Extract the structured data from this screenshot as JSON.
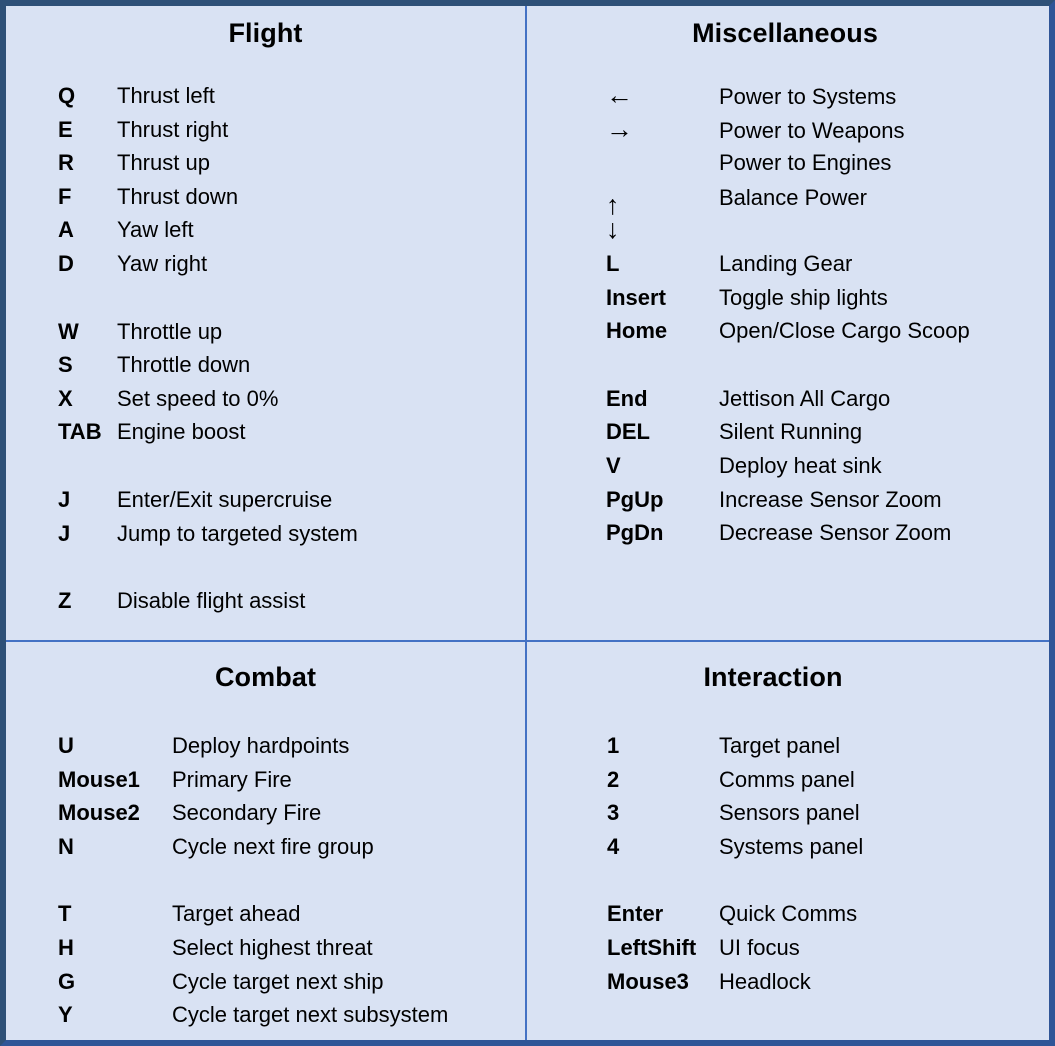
{
  "card": {
    "background_color": "#D9E2F3",
    "border_color": "#2E5077",
    "divider_color": "#4472C4"
  },
  "panels": [
    {
      "id": "flight",
      "title": "Flight",
      "groups": [
        {
          "rows": [
            {
              "key": "Q",
              "desc": "Thrust left"
            },
            {
              "key": "E",
              "desc": "Thrust right"
            },
            {
              "key": "R",
              "desc": "Thrust up"
            },
            {
              "key": "F",
              "desc": "Thrust down"
            },
            {
              "key": "A",
              "desc": "Yaw left"
            },
            {
              "key": "D",
              "desc": "Yaw right"
            }
          ]
        },
        {
          "rows": [
            {
              "key": "W",
              "desc": "Throttle up"
            },
            {
              "key": "S",
              "desc": "Throttle down"
            },
            {
              "key": "X",
              "desc": "Set speed to 0%"
            },
            {
              "key": "TAB",
              "desc": "Engine boost"
            }
          ]
        },
        {
          "rows": [
            {
              "key": "J",
              "desc": "Enter/Exit supercruise"
            },
            {
              "key": "J",
              "desc": "Jump to targeted system"
            }
          ]
        },
        {
          "rows": [
            {
              "key": "Z",
              "desc": "Disable flight assist"
            }
          ]
        }
      ]
    },
    {
      "id": "miscellaneous",
      "title": "Miscellaneous",
      "groups": [
        {
          "rows": [
            {
              "key": "←",
              "desc": "Power to Systems",
              "key_style": "arrow"
            },
            {
              "key": "→",
              "desc": "Power to Weapons",
              "key_style": "arrow"
            },
            {
              "key": "",
              "desc": "Power to Engines"
            },
            {
              "key": "↑",
              "desc": "Balance Power",
              "key_style": "arrow",
              "key_nudge": true
            },
            {
              "key": "↓",
              "desc": "",
              "key_style": "arrow"
            },
            {
              "key": "L",
              "desc": "Landing Gear"
            },
            {
              "key": "Insert",
              "desc": "Toggle ship lights"
            },
            {
              "key": "Home",
              "desc": "Open/Close Cargo Scoop"
            }
          ]
        },
        {
          "rows": [
            {
              "key": "End",
              "desc": "Jettison All Cargo"
            },
            {
              "key": "DEL",
              "desc": "Silent Running"
            },
            {
              "key": "V",
              "desc": "Deploy heat sink"
            },
            {
              "key": "PgUp",
              "desc": "Increase Sensor Zoom"
            },
            {
              "key": "PgDn",
              "desc": "Decrease Sensor Zoom"
            }
          ]
        }
      ]
    },
    {
      "id": "combat",
      "title": "Combat",
      "groups": [
        {
          "rows": [
            {
              "key": "U",
              "desc": "Deploy hardpoints"
            },
            {
              "key": "Mouse1",
              "desc": "Primary Fire"
            },
            {
              "key": "Mouse2",
              "desc": "Secondary Fire"
            },
            {
              "key": "N",
              "desc": "Cycle next fire group"
            }
          ]
        },
        {
          "rows": [
            {
              "key": "T",
              "desc": "Target ahead"
            },
            {
              "key": "H",
              "desc": "Select highest threat"
            },
            {
              "key": "G",
              "desc": "Cycle target next ship"
            },
            {
              "key": "Y",
              "desc": "Cycle target next subsystem"
            }
          ]
        }
      ]
    },
    {
      "id": "interaction",
      "title": "Interaction",
      "groups": [
        {
          "rows": [
            {
              "key": "1",
              "desc": "Target panel"
            },
            {
              "key": "2",
              "desc": "Comms panel"
            },
            {
              "key": "3",
              "desc": "Sensors panel"
            },
            {
              "key": "4",
              "desc": "Systems panel"
            }
          ]
        },
        {
          "rows": [
            {
              "key": "Enter",
              "desc": "Quick Comms"
            },
            {
              "key": "LeftShift",
              "desc": "UI focus"
            },
            {
              "key": "Mouse3",
              "desc": "Headlock"
            }
          ]
        }
      ]
    }
  ]
}
